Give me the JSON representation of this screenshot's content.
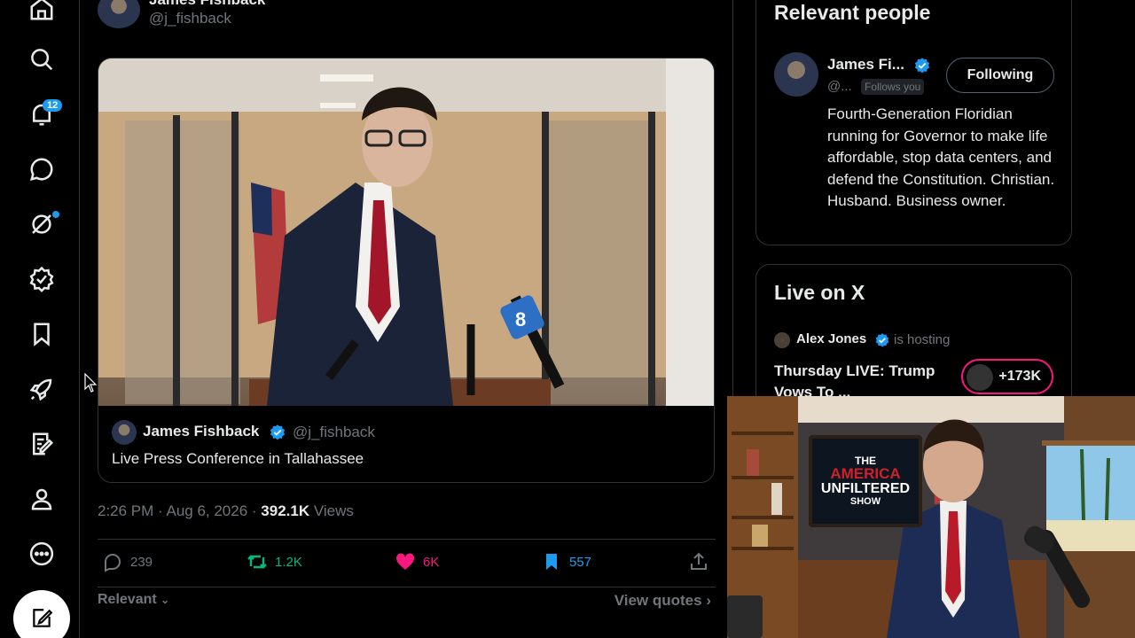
{
  "nav": {
    "notifications_badge": "12",
    "items": [
      "home-icon",
      "search-icon",
      "notifications-icon",
      "messages-icon",
      "grok-icon",
      "verified-icon",
      "bookmarks-icon",
      "premium-rocket-icon",
      "articles-icon",
      "profile-icon",
      "more-icon"
    ]
  },
  "post": {
    "author_handle": "@j_fishback",
    "author_name": "James Fishback",
    "quoted": {
      "name": "James Fishback",
      "handle": "@j_fishback",
      "text": "Live Press Conference in Tallahassee"
    },
    "time": "2:26 PM · Aug 6, 2026",
    "views_count": "392.1K",
    "views_label": "Views",
    "replies": "239",
    "reposts": "1.2K",
    "likes": "6K",
    "bookmarks": "557",
    "sort_label": "Relevant",
    "view_quotes": "View quotes"
  },
  "relevant_people": {
    "title": "Relevant people",
    "name": "James Fi...",
    "handle": "@...",
    "follows_you": "Follows you",
    "button": "Following",
    "bio": "Fourth-Generation Floridian running for Governor to make life affordable, stop data centers, and defend the Constitution. Christian. Husband. Business owner."
  },
  "live": {
    "title": "Live on X",
    "host": "Alex Jones",
    "hosting_label": "is hosting",
    "topic": "Thursday LIVE: Trump Vows To ...",
    "listeners": "+173K"
  },
  "webcam": {
    "tv_line1": "THE",
    "tv_line2": "AMERICA",
    "tv_line3": "UNFILTERED",
    "tv_line4": "SHOW"
  },
  "colors": {
    "accent": "#1d9bf0",
    "repost": "#00ba7c",
    "like": "#f91880",
    "background": "#000000",
    "border": "#2f3336"
  }
}
